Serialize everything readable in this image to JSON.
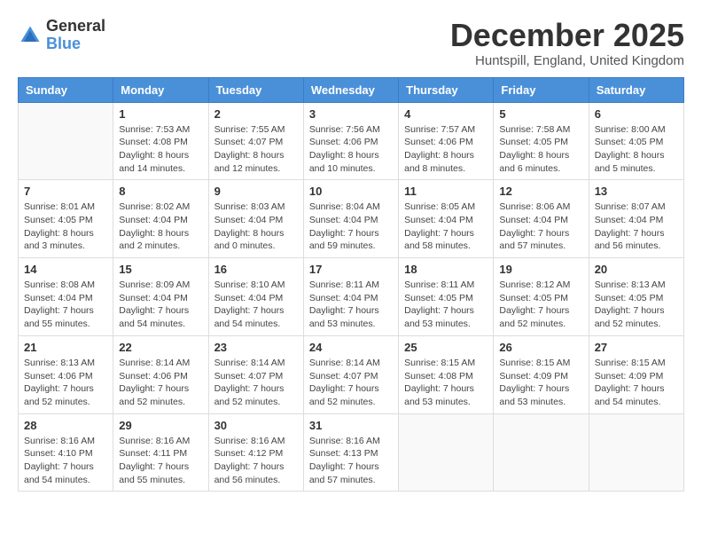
{
  "header": {
    "logo_general": "General",
    "logo_blue": "Blue",
    "month_title": "December 2025",
    "location": "Huntspill, England, United Kingdom"
  },
  "days_of_week": [
    "Sunday",
    "Monday",
    "Tuesday",
    "Wednesday",
    "Thursday",
    "Friday",
    "Saturday"
  ],
  "weeks": [
    [
      {
        "day": "",
        "sunrise": "",
        "sunset": "",
        "daylight": ""
      },
      {
        "day": "1",
        "sunrise": "Sunrise: 7:53 AM",
        "sunset": "Sunset: 4:08 PM",
        "daylight": "Daylight: 8 hours and 14 minutes."
      },
      {
        "day": "2",
        "sunrise": "Sunrise: 7:55 AM",
        "sunset": "Sunset: 4:07 PM",
        "daylight": "Daylight: 8 hours and 12 minutes."
      },
      {
        "day": "3",
        "sunrise": "Sunrise: 7:56 AM",
        "sunset": "Sunset: 4:06 PM",
        "daylight": "Daylight: 8 hours and 10 minutes."
      },
      {
        "day": "4",
        "sunrise": "Sunrise: 7:57 AM",
        "sunset": "Sunset: 4:06 PM",
        "daylight": "Daylight: 8 hours and 8 minutes."
      },
      {
        "day": "5",
        "sunrise": "Sunrise: 7:58 AM",
        "sunset": "Sunset: 4:05 PM",
        "daylight": "Daylight: 8 hours and 6 minutes."
      },
      {
        "day": "6",
        "sunrise": "Sunrise: 8:00 AM",
        "sunset": "Sunset: 4:05 PM",
        "daylight": "Daylight: 8 hours and 5 minutes."
      }
    ],
    [
      {
        "day": "7",
        "sunrise": "Sunrise: 8:01 AM",
        "sunset": "Sunset: 4:05 PM",
        "daylight": "Daylight: 8 hours and 3 minutes."
      },
      {
        "day": "8",
        "sunrise": "Sunrise: 8:02 AM",
        "sunset": "Sunset: 4:04 PM",
        "daylight": "Daylight: 8 hours and 2 minutes."
      },
      {
        "day": "9",
        "sunrise": "Sunrise: 8:03 AM",
        "sunset": "Sunset: 4:04 PM",
        "daylight": "Daylight: 8 hours and 0 minutes."
      },
      {
        "day": "10",
        "sunrise": "Sunrise: 8:04 AM",
        "sunset": "Sunset: 4:04 PM",
        "daylight": "Daylight: 7 hours and 59 minutes."
      },
      {
        "day": "11",
        "sunrise": "Sunrise: 8:05 AM",
        "sunset": "Sunset: 4:04 PM",
        "daylight": "Daylight: 7 hours and 58 minutes."
      },
      {
        "day": "12",
        "sunrise": "Sunrise: 8:06 AM",
        "sunset": "Sunset: 4:04 PM",
        "daylight": "Daylight: 7 hours and 57 minutes."
      },
      {
        "day": "13",
        "sunrise": "Sunrise: 8:07 AM",
        "sunset": "Sunset: 4:04 PM",
        "daylight": "Daylight: 7 hours and 56 minutes."
      }
    ],
    [
      {
        "day": "14",
        "sunrise": "Sunrise: 8:08 AM",
        "sunset": "Sunset: 4:04 PM",
        "daylight": "Daylight: 7 hours and 55 minutes."
      },
      {
        "day": "15",
        "sunrise": "Sunrise: 8:09 AM",
        "sunset": "Sunset: 4:04 PM",
        "daylight": "Daylight: 7 hours and 54 minutes."
      },
      {
        "day": "16",
        "sunrise": "Sunrise: 8:10 AM",
        "sunset": "Sunset: 4:04 PM",
        "daylight": "Daylight: 7 hours and 54 minutes."
      },
      {
        "day": "17",
        "sunrise": "Sunrise: 8:11 AM",
        "sunset": "Sunset: 4:04 PM",
        "daylight": "Daylight: 7 hours and 53 minutes."
      },
      {
        "day": "18",
        "sunrise": "Sunrise: 8:11 AM",
        "sunset": "Sunset: 4:05 PM",
        "daylight": "Daylight: 7 hours and 53 minutes."
      },
      {
        "day": "19",
        "sunrise": "Sunrise: 8:12 AM",
        "sunset": "Sunset: 4:05 PM",
        "daylight": "Daylight: 7 hours and 52 minutes."
      },
      {
        "day": "20",
        "sunrise": "Sunrise: 8:13 AM",
        "sunset": "Sunset: 4:05 PM",
        "daylight": "Daylight: 7 hours and 52 minutes."
      }
    ],
    [
      {
        "day": "21",
        "sunrise": "Sunrise: 8:13 AM",
        "sunset": "Sunset: 4:06 PM",
        "daylight": "Daylight: 7 hours and 52 minutes."
      },
      {
        "day": "22",
        "sunrise": "Sunrise: 8:14 AM",
        "sunset": "Sunset: 4:06 PM",
        "daylight": "Daylight: 7 hours and 52 minutes."
      },
      {
        "day": "23",
        "sunrise": "Sunrise: 8:14 AM",
        "sunset": "Sunset: 4:07 PM",
        "daylight": "Daylight: 7 hours and 52 minutes."
      },
      {
        "day": "24",
        "sunrise": "Sunrise: 8:14 AM",
        "sunset": "Sunset: 4:07 PM",
        "daylight": "Daylight: 7 hours and 52 minutes."
      },
      {
        "day": "25",
        "sunrise": "Sunrise: 8:15 AM",
        "sunset": "Sunset: 4:08 PM",
        "daylight": "Daylight: 7 hours and 53 minutes."
      },
      {
        "day": "26",
        "sunrise": "Sunrise: 8:15 AM",
        "sunset": "Sunset: 4:09 PM",
        "daylight": "Daylight: 7 hours and 53 minutes."
      },
      {
        "day": "27",
        "sunrise": "Sunrise: 8:15 AM",
        "sunset": "Sunset: 4:09 PM",
        "daylight": "Daylight: 7 hours and 54 minutes."
      }
    ],
    [
      {
        "day": "28",
        "sunrise": "Sunrise: 8:16 AM",
        "sunset": "Sunset: 4:10 PM",
        "daylight": "Daylight: 7 hours and 54 minutes."
      },
      {
        "day": "29",
        "sunrise": "Sunrise: 8:16 AM",
        "sunset": "Sunset: 4:11 PM",
        "daylight": "Daylight: 7 hours and 55 minutes."
      },
      {
        "day": "30",
        "sunrise": "Sunrise: 8:16 AM",
        "sunset": "Sunset: 4:12 PM",
        "daylight": "Daylight: 7 hours and 56 minutes."
      },
      {
        "day": "31",
        "sunrise": "Sunrise: 8:16 AM",
        "sunset": "Sunset: 4:13 PM",
        "daylight": "Daylight: 7 hours and 57 minutes."
      },
      {
        "day": "",
        "sunrise": "",
        "sunset": "",
        "daylight": ""
      },
      {
        "day": "",
        "sunrise": "",
        "sunset": "",
        "daylight": ""
      },
      {
        "day": "",
        "sunrise": "",
        "sunset": "",
        "daylight": ""
      }
    ]
  ]
}
